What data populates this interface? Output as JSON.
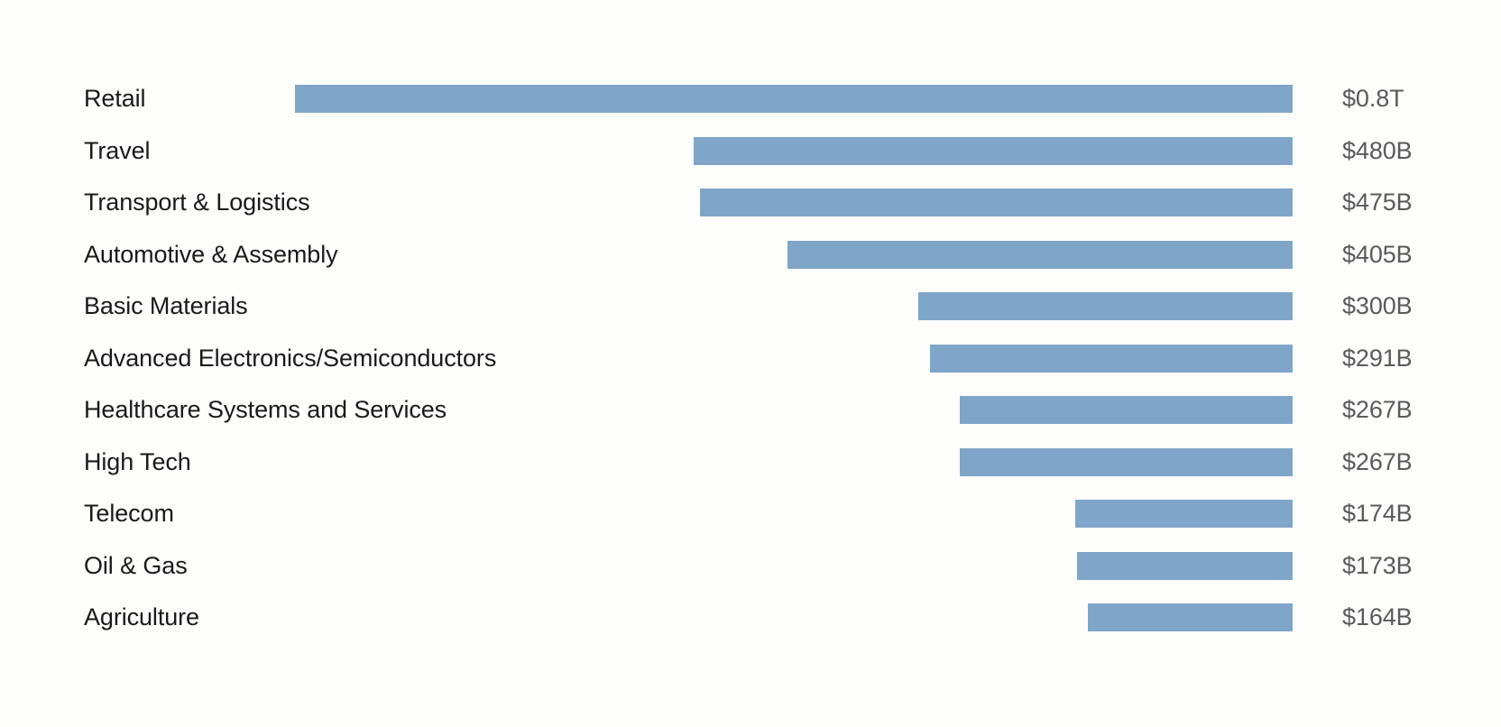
{
  "chart_data": {
    "type": "bar",
    "orientation": "horizontal",
    "title": "",
    "subtitle": "",
    "xlabel": "",
    "ylabel": "",
    "grid": false,
    "legend": false,
    "axis_visible": false,
    "bar_alignment": "right-aligned",
    "value_unit": "USD",
    "xlim": [
      0,
      800
    ],
    "categories": [
      "Retail",
      "Travel",
      "Transport & Logistics",
      "Automotive & Assembly",
      "Basic Materials",
      "Advanced Electronics/Semiconductors",
      "Healthcare Systems and Services",
      "High Tech",
      "Telecom",
      "Oil & Gas",
      "Agriculture"
    ],
    "values": [
      800,
      480,
      475,
      405,
      300,
      291,
      267,
      267,
      174,
      173,
      164
    ],
    "value_labels": [
      "$0.8T",
      "$480B",
      "$475B",
      "$405B",
      "$300B",
      "$291B",
      "$267B",
      "$267B",
      "$174B",
      "$173B",
      "$164B"
    ],
    "colors": {
      "bar": "#7fa6c8",
      "category_label": "#1a1a1a",
      "value_label": "#5a5a5a",
      "background": "#fdfdfc"
    }
  },
  "rows": [
    {
      "label": "Retail",
      "value_label": "$0.8T",
      "value": 800
    },
    {
      "label": "Travel",
      "value_label": "$480B",
      "value": 480
    },
    {
      "label": "Transport & Logistics",
      "value_label": "$475B",
      "value": 475
    },
    {
      "label": "Automotive & Assembly",
      "value_label": "$405B",
      "value": 405
    },
    {
      "label": "Basic Materials",
      "value_label": "$300B",
      "value": 300
    },
    {
      "label": "Advanced Electronics/Semiconductors",
      "value_label": "$291B",
      "value": 291
    },
    {
      "label": "Healthcare Systems and Services",
      "value_label": "$267B",
      "value": 267
    },
    {
      "label": "High Tech",
      "value_label": "$267B",
      "value": 267
    },
    {
      "label": "Telecom",
      "value_label": "$174B",
      "value": 174
    },
    {
      "label": "Oil & Gas",
      "value_label": "$173B",
      "value": 173
    },
    {
      "label": "Agriculture",
      "value_label": "$164B",
      "value": 164
    }
  ]
}
